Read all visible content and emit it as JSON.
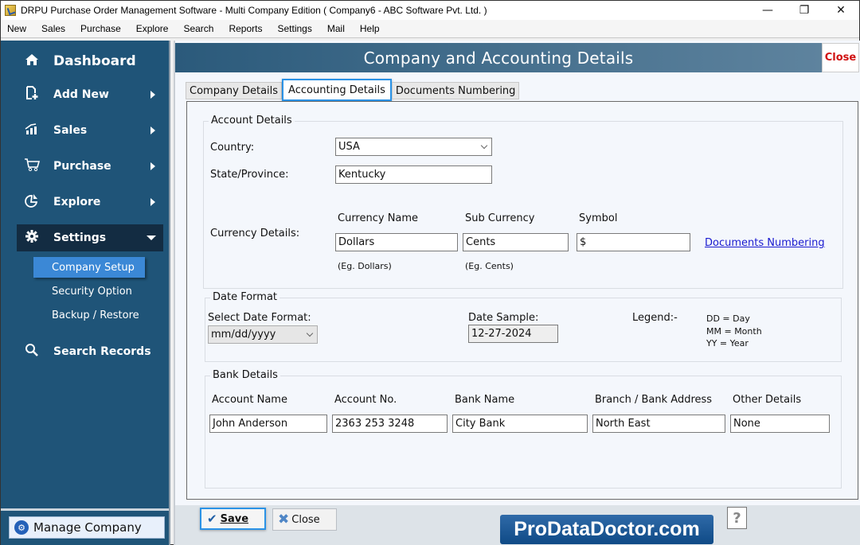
{
  "window": {
    "title": "DRPU Purchase Order Management Software - Multi Company Edition ( Company6 - ABC Software Pvt. Ltd. )",
    "controls": {
      "minimize": "—",
      "maximize": "❐",
      "close": "✕"
    }
  },
  "menubar": [
    "New",
    "Sales",
    "Purchase",
    "Explore",
    "Search",
    "Reports",
    "Settings",
    "Mail",
    "Help"
  ],
  "sidebar": {
    "dashboard": {
      "label": "Dashboard",
      "icon": "home-icon"
    },
    "items": [
      {
        "label": "Add New",
        "icon": "add-document-icon",
        "expandable": true
      },
      {
        "label": "Sales",
        "icon": "sales-chart-icon",
        "expandable": true
      },
      {
        "label": "Purchase",
        "icon": "cart-icon",
        "expandable": true
      },
      {
        "label": "Explore",
        "icon": "pie-chart-icon",
        "expandable": true
      },
      {
        "label": "Settings",
        "icon": "gear-icon",
        "expanded": true,
        "active": true
      }
    ],
    "settings_subitems": [
      {
        "label": "Company Setup",
        "active": true
      },
      {
        "label": "Security Option"
      },
      {
        "label": "Backup / Restore"
      }
    ],
    "search_records": {
      "label": "Search Records",
      "icon": "search-icon"
    },
    "manage_company": "Manage Company"
  },
  "header": {
    "title": "Company and Accounting Details",
    "close_label": "Close"
  },
  "tabs": [
    {
      "label": "Company Details"
    },
    {
      "label": "Accounting Details",
      "active": true
    },
    {
      "label": "Documents Numbering"
    }
  ],
  "account_details": {
    "legend": "Account Details",
    "country_label": "Country:",
    "country_value": "USA",
    "state_label": "State/Province:",
    "state_value": "Kentucky",
    "currency_label": "Currency Details:",
    "currency_name_label": "Currency Name",
    "currency_name_value": "Dollars",
    "currency_name_hint": "(Eg. Dollars)",
    "sub_currency_label": "Sub Currency",
    "sub_currency_value": "Cents",
    "sub_currency_hint": "(Eg. Cents)",
    "symbol_label": "Symbol",
    "symbol_value": "$",
    "documents_numbering_link": "Documents Numbering"
  },
  "date_format": {
    "legend": "Date Format",
    "select_label": "Select Date Format:",
    "select_value": "mm/dd/yyyy",
    "sample_label": "Date Sample:",
    "sample_value": "12-27-2024",
    "legend_label": "Legend:-",
    "legend_items": [
      "DD = Day",
      "MM = Month",
      "YY = Year"
    ]
  },
  "bank_details": {
    "legend": "Bank Details",
    "columns": [
      "Account Name",
      "Account No.",
      "Bank Name",
      "Branch / Bank Address",
      "Other Details"
    ],
    "values": [
      "John Anderson",
      "2363 253 3248",
      "City Bank",
      "North East",
      "None"
    ]
  },
  "footer": {
    "save_label": "Save",
    "close_label": "Close",
    "help_label": "?",
    "brand": "ProDataDoctor.com"
  }
}
